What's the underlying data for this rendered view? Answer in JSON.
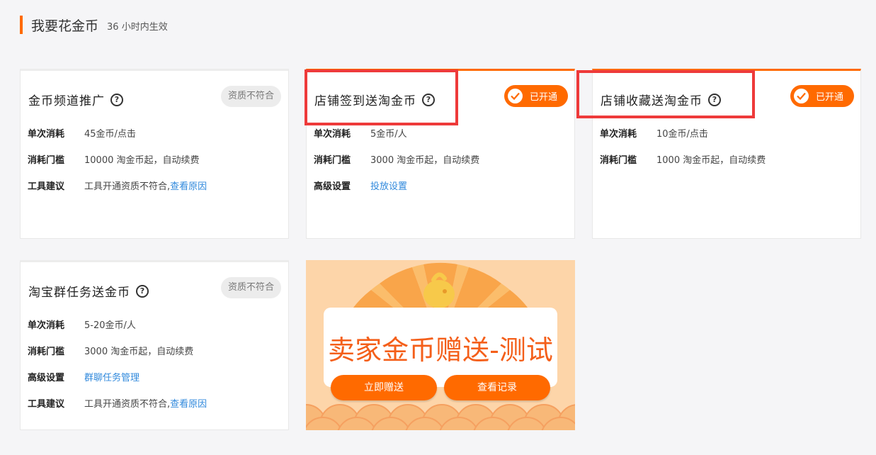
{
  "header": {
    "title": "我要花金币",
    "note": "36 小时内生效"
  },
  "labels": {
    "cost": "单次消耗",
    "threshold": "消耗门槛",
    "advice": "工具建议",
    "advanced": "高级设置"
  },
  "badges": {
    "ineligible": "资质不符合",
    "enabled": "已开通"
  },
  "cards": [
    {
      "title": "金币频道推广",
      "cost": "45金币/点击",
      "threshold": "10000 淘金币起，自动续费",
      "advice_text": "工具开通资质不符合,",
      "advice_link": "查看原因"
    },
    {
      "title": "店铺签到送淘金币",
      "cost": "5金币/人",
      "threshold": "3000 淘金币起，自动续费",
      "advanced_link": "投放设置"
    },
    {
      "title": "店铺收藏送淘金币",
      "cost": "10金币/点击",
      "threshold": "1000 淘金币起，自动续费"
    },
    {
      "title": "淘宝群任务送金币",
      "cost": "5-20金币/人",
      "threshold": "3000 淘金币起，自动续费",
      "advanced_link": "群聊任务管理",
      "advice_text": "工具开通资质不符合,",
      "advice_link": "查看原因"
    }
  ],
  "promo": {
    "title": "卖家金币赠送-测试",
    "gift_button": "立即赠送",
    "record_button": "查看记录"
  },
  "colors": {
    "accent": "#ff6a00",
    "link": "#3089dc",
    "highlight_box": "#ee3a3a",
    "promo_background": "#fdd5a9"
  }
}
